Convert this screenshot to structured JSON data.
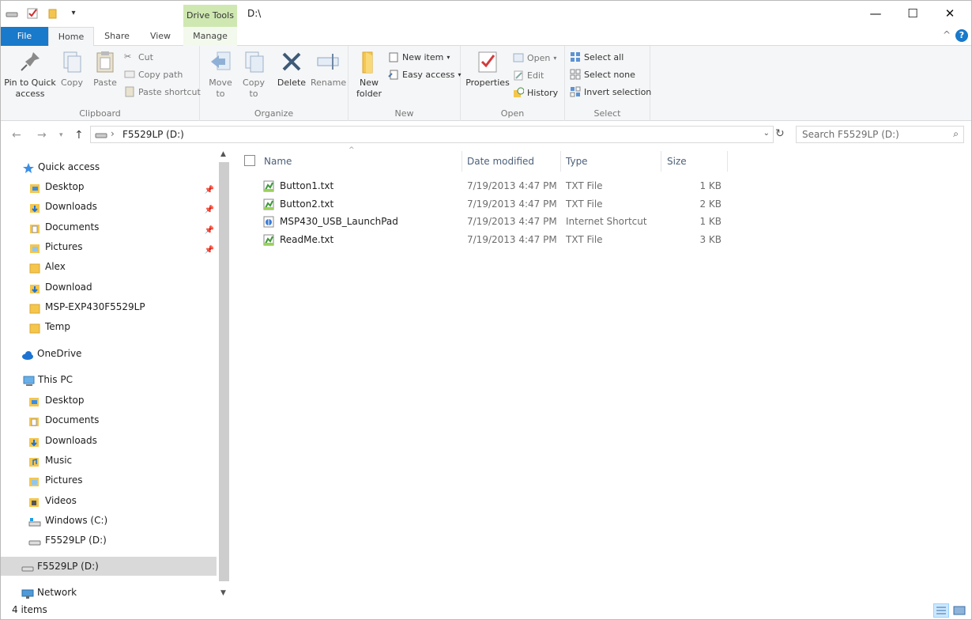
{
  "titlebar": {
    "contextual_tab": "Drive Tools",
    "path": "D:\\",
    "minimize": "—",
    "maximize": "☐",
    "close": "✕"
  },
  "tabs": [
    {
      "label": "File"
    },
    {
      "label": "Home"
    },
    {
      "label": "Share"
    },
    {
      "label": "View"
    },
    {
      "label": "Manage"
    }
  ],
  "ribbon": {
    "clipboard": {
      "label": "Clipboard",
      "pin_label": "Pin to Quick access",
      "copy_label": "Copy",
      "paste_label": "Paste",
      "cut_label": "Cut",
      "copy_path_label": "Copy path",
      "paste_shortcut_label": "Paste shortcut"
    },
    "organize": {
      "label": "Organize",
      "move_to_label": "Move to",
      "copy_to_label": "Copy to",
      "delete_label": "Delete",
      "rename_label": "Rename"
    },
    "new": {
      "label": "New",
      "new_folder_label": "New folder",
      "new_item_label": "New item",
      "easy_access_label": "Easy access"
    },
    "open": {
      "label": "Open",
      "properties_label": "Properties",
      "open_label": "Open",
      "edit_label": "Edit",
      "history_label": "History"
    },
    "select": {
      "label": "Select",
      "select_all_label": "Select all",
      "select_none_label": "Select none",
      "invert_label": "Invert selection"
    }
  },
  "address": {
    "location": "F5529LP (D:)",
    "search_placeholder": "Search F5529LP (D:)"
  },
  "nav": {
    "quick_access": "Quick access",
    "quick_items": [
      {
        "label": "Desktop",
        "pinned": true
      },
      {
        "label": "Downloads",
        "pinned": true
      },
      {
        "label": "Documents",
        "pinned": true
      },
      {
        "label": "Pictures",
        "pinned": true
      },
      {
        "label": "Alex",
        "pinned": false
      },
      {
        "label": "Download",
        "pinned": false
      },
      {
        "label": "MSP-EXP430F5529LP",
        "pinned": false
      },
      {
        "label": "Temp",
        "pinned": false
      }
    ],
    "onedrive": "OneDrive",
    "this_pc": "This PC",
    "pc_items": [
      {
        "label": "Desktop"
      },
      {
        "label": "Documents"
      },
      {
        "label": "Downloads"
      },
      {
        "label": "Music"
      },
      {
        "label": "Pictures"
      },
      {
        "label": "Videos"
      },
      {
        "label": "Windows (C:)"
      },
      {
        "label": "F5529LP (D:)"
      }
    ],
    "selected_drive": "F5529LP (D:)",
    "network": "Network"
  },
  "columns": {
    "name": "Name",
    "date": "Date modified",
    "type": "Type",
    "size": "Size"
  },
  "files": [
    {
      "name": "Button1.txt",
      "date": "7/19/2013 4:47 PM",
      "type": "TXT File",
      "size": "1 KB",
      "icon": "txt"
    },
    {
      "name": "Button2.txt",
      "date": "7/19/2013 4:47 PM",
      "type": "TXT File",
      "size": "2 KB",
      "icon": "txt"
    },
    {
      "name": "MSP430_USB_LaunchPad",
      "date": "7/19/2013 4:47 PM",
      "type": "Internet Shortcut",
      "size": "1 KB",
      "icon": "url"
    },
    {
      "name": "ReadMe.txt",
      "date": "7/19/2013 4:47 PM",
      "type": "TXT File",
      "size": "3 KB",
      "icon": "txt"
    }
  ],
  "status": {
    "item_count": "4 items"
  },
  "colors": {
    "file_tab": "#1979ca",
    "drive_tools": "#cfe8b2",
    "selection": "#d9d9d9"
  }
}
